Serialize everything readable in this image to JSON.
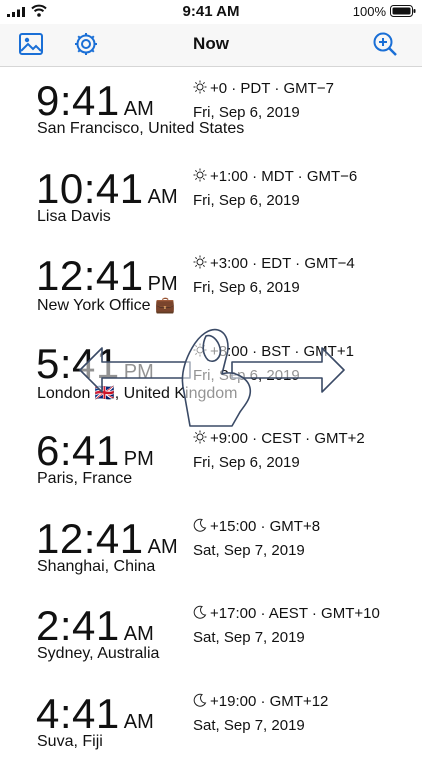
{
  "status_bar": {
    "time": "9:41 AM",
    "battery": "100%"
  },
  "nav": {
    "title": "Now",
    "left_icons": [
      "photo-icon",
      "gear-icon"
    ],
    "right_icon": "zoom-in-icon",
    "accent_color": "#1a6fd6"
  },
  "clocks": [
    {
      "time": "9:41",
      "ampm": "AM",
      "city": "San Francisco, United States",
      "icon": "sun",
      "offset": "+0 · PDT · GMT−7",
      "date": "Fri, Sep 6, 2019"
    },
    {
      "time": "10:41",
      "ampm": "AM",
      "city": "Lisa Davis",
      "icon": "sun",
      "offset": "+1:00 · MDT · GMT−6",
      "date": "Fri, Sep 6, 2019"
    },
    {
      "time": "12:41",
      "ampm": "PM",
      "city": "New York Office 💼",
      "icon": "sun",
      "offset": "+3:00 · EDT · GMT−4",
      "date": "Fri, Sep 6, 2019"
    },
    {
      "time": "5:41",
      "ampm": "PM",
      "city": "London 🇬🇧, United Kingdom",
      "icon": "sun",
      "offset": "+8:00 · BST · GMT+1",
      "date": "Fri, Sep 6, 2019"
    },
    {
      "time": "6:41",
      "ampm": "PM",
      "city": "Paris, France",
      "icon": "sun",
      "offset": "+9:00 · CEST · GMT+2",
      "date": "Fri, Sep 6, 2019"
    },
    {
      "time": "12:41",
      "ampm": "AM",
      "city": "Shanghai, China",
      "icon": "moon",
      "offset": "+15:00 · GMT+8",
      "date": "Sat, Sep 7, 2019"
    },
    {
      "time": "2:41",
      "ampm": "AM",
      "city": "Sydney, Australia",
      "icon": "moon",
      "offset": "+17:00 · AEST · GMT+10",
      "date": "Sat, Sep 7, 2019"
    },
    {
      "time": "4:41",
      "ampm": "AM",
      "city": "Suva, Fiji",
      "icon": "moon",
      "offset": "+19:00 · GMT+12",
      "date": "Sat, Sep 7, 2019"
    }
  ],
  "gesture_hint": "swipe-left-right"
}
